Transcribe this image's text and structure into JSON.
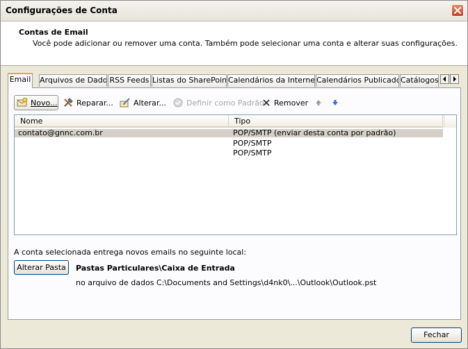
{
  "window": {
    "title": "Configurações de Conta",
    "close_icon": "close-icon"
  },
  "header": {
    "title": "Contas de Email",
    "description": "Você pode adicionar ou remover uma conta. Também pode selecionar uma conta e alterar suas configurações."
  },
  "tabs": [
    {
      "label": "Email",
      "active": true
    },
    {
      "label": "Arquivos de Dados"
    },
    {
      "label": "RSS Feeds"
    },
    {
      "label": "Listas do SharePoint"
    },
    {
      "label": "Calendários da Internet"
    },
    {
      "label": "Calendários Publicados"
    },
    {
      "label": "Catálogos"
    }
  ],
  "toolbar": {
    "new_label": "Novo...",
    "repair_label": "Reparar...",
    "change_label": "Alterar...",
    "set_default_label": "Definir como Padrão",
    "remove_label": "Remover"
  },
  "list": {
    "columns": {
      "name": "Nome",
      "type": "Tipo"
    },
    "rows": [
      {
        "name": "contato@gnnc.com.br",
        "type": "POP/SMTP (enviar desta conta por padrão)",
        "selected": true
      },
      {
        "name": "",
        "type": "POP/SMTP"
      },
      {
        "name": "",
        "type": "POP/SMTP"
      }
    ]
  },
  "delivery": {
    "label": "A conta selecionada entrega novos emails no seguinte local:",
    "change_folder_label": "Alterar Pasta",
    "folder_name": "Pastas Particulares\\Caixa de Entrada",
    "folder_path": "no arquivo de dados C:\\Documents and Settings\\d4nk0\\...\\Outlook\\Outlook.pst"
  },
  "footer": {
    "close_label": "Fechar"
  },
  "colors": {
    "tab_accent": "#e8a440",
    "close_button": "#c4401f",
    "arrow_blue": "#3a6fd8"
  }
}
